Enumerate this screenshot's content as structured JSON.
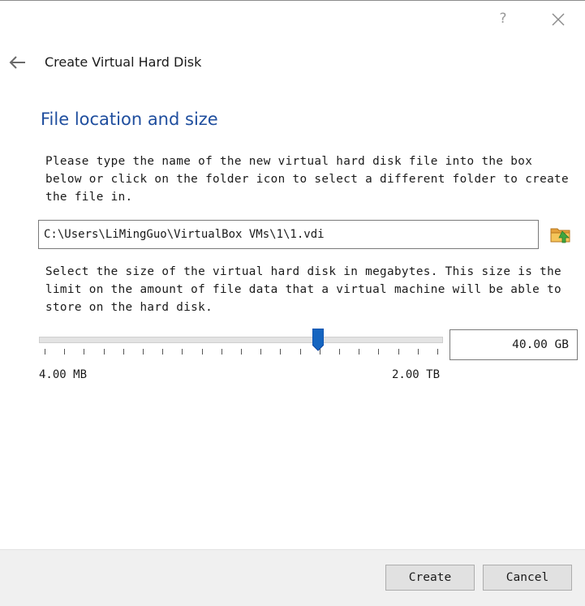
{
  "titlebar": {
    "help_label": "?",
    "icons": {
      "close": "close-icon"
    }
  },
  "wizard": {
    "back_icon": "back-arrow-icon",
    "title": "Create Virtual Hard Disk"
  },
  "page": {
    "section_title": "File location and size",
    "location_description": "Please type the name of the new virtual hard disk file into the box below or click on the folder icon to select a different folder to create the file in.",
    "location_value": "C:\\Users\\LiMingGuo\\VirtualBox VMs\\1\\1.vdi",
    "folder_icon": "folder-icon",
    "size_description": "Select the size of the virtual hard disk in megabytes. This size is the limit on the amount of file data that a virtual machine will be able to store on the hard disk.",
    "slider": {
      "min_label": "4.00 MB",
      "max_label": "2.00 TB",
      "value_fraction": 0.69
    },
    "size_value": "40.00 GB"
  },
  "footer": {
    "create_label": "Create",
    "cancel_label": "Cancel"
  },
  "colors": {
    "accent": "#1f4e9e",
    "slider_handle": "#1565c0",
    "footer_bg": "#f0f0f0",
    "button_bg": "#e1e1e1"
  }
}
